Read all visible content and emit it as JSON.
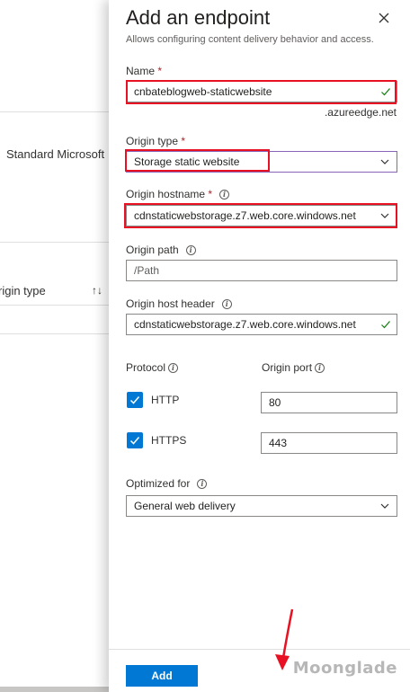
{
  "background": {
    "row_text": "Standard Microsoft",
    "column_header": "rigin type",
    "sort_icon": "↑↓"
  },
  "panel": {
    "title": "Add an endpoint",
    "subtitle": "Allows configuring content delivery behavior and access.",
    "close_icon": "close-icon"
  },
  "form": {
    "name": {
      "label": "Name",
      "required": "*",
      "value": "cnbateblogweb-staticwebsite",
      "suffix": ".azureedge.net"
    },
    "origin_type": {
      "label": "Origin type",
      "required": "*",
      "value": "Storage static website"
    },
    "origin_hostname": {
      "label": "Origin hostname",
      "required": "*",
      "value": "cdnstaticwebstorage.z7.web.core.windows.net"
    },
    "origin_path": {
      "label": "Origin path",
      "placeholder": "/Path"
    },
    "origin_host_header": {
      "label": "Origin host header",
      "value": "cdnstaticwebstorage.z7.web.core.windows.net"
    },
    "protocol": {
      "label": "Protocol",
      "http": "HTTP",
      "https": "HTTPS"
    },
    "origin_port": {
      "label": "Origin port",
      "http_port": "80",
      "https_port": "443"
    },
    "optimized_for": {
      "label": "Optimized for",
      "value": "General web delivery"
    }
  },
  "footer": {
    "add_label": "Add",
    "watermark": "Moonglade"
  },
  "colors": {
    "accent": "#0078d4",
    "highlight": "#e81123",
    "success": "#107c10"
  }
}
